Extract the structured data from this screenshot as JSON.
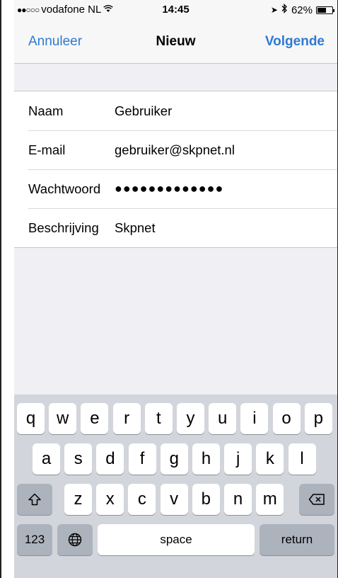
{
  "status_bar": {
    "signal": "●●○○○",
    "carrier": "vodafone NL",
    "wifi_icon": "wifi-icon",
    "time": "14:45",
    "location_icon": "➤",
    "bluetooth_icon": "✱",
    "battery_percent": "62%",
    "battery_level": 0.62
  },
  "nav": {
    "cancel_label": "Annuleer",
    "title": "Nieuw",
    "next_label": "Volgende"
  },
  "form": {
    "rows": [
      {
        "label": "Naam",
        "value": "Gebruiker"
      },
      {
        "label": "E-mail",
        "value": "gebruiker@skpnet.nl"
      },
      {
        "label": "Wachtwoord",
        "value": "●●●●●●●●●●●●●"
      },
      {
        "label": "Beschrijving",
        "value": "Skpnet"
      }
    ]
  },
  "keyboard": {
    "row1": [
      "q",
      "w",
      "e",
      "r",
      "t",
      "y",
      "u",
      "i",
      "o",
      "p"
    ],
    "row2": [
      "a",
      "s",
      "d",
      "f",
      "g",
      "h",
      "j",
      "k",
      "l"
    ],
    "row3": [
      "z",
      "x",
      "c",
      "v",
      "b",
      "n",
      "m"
    ],
    "numbers_label": "123",
    "space_label": "space",
    "return_label": "return",
    "shift_icon": "shift-icon",
    "delete_icon": "delete-icon",
    "globe_icon": "globe-icon"
  }
}
